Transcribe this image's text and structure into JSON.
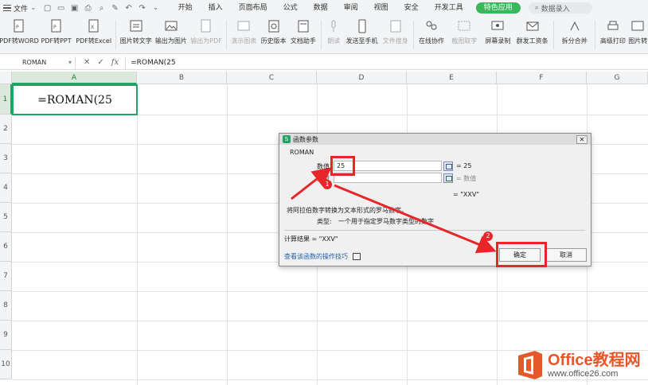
{
  "menubar": {
    "file": "文件",
    "tabs": [
      "开始",
      "插入",
      "页面布局",
      "公式",
      "数据",
      "审阅",
      "视图",
      "安全",
      "开发工具"
    ],
    "special_tab": "特色应用",
    "search": "数据录入"
  },
  "toolbar": {
    "items": [
      {
        "label": "PDF转WORD",
        "icon": "pdf-to-word-icon",
        "enabled": true
      },
      {
        "label": "PDF转PPT",
        "icon": "pdf-to-ppt-icon",
        "enabled": true
      },
      {
        "label": "PDF转Excel",
        "icon": "pdf-to-excel-icon",
        "enabled": true
      },
      {
        "label": "图片转文字",
        "icon": "image-to-text-icon",
        "enabled": true
      },
      {
        "label": "输出为图片",
        "icon": "export-image-icon",
        "enabled": true
      },
      {
        "label": "输出为PDF",
        "icon": "export-pdf-icon",
        "enabled": false
      },
      {
        "label": "演示图表",
        "icon": "demo-chart-icon",
        "enabled": false
      },
      {
        "label": "历史版本",
        "icon": "history-icon",
        "enabled": true
      },
      {
        "label": "文档助手",
        "icon": "doc-assistant-icon",
        "enabled": true
      },
      {
        "label": "朗读",
        "icon": "read-aloud-icon",
        "enabled": false
      },
      {
        "label": "发送至手机",
        "icon": "send-phone-icon",
        "enabled": true
      },
      {
        "label": "文件搜身",
        "icon": "file-search-icon",
        "enabled": false
      },
      {
        "label": "在线协作",
        "icon": "online-collab-icon",
        "enabled": true
      },
      {
        "label": "截图取字",
        "icon": "screenshot-text-icon",
        "enabled": false
      },
      {
        "label": "屏幕录制",
        "icon": "screen-record-icon",
        "enabled": true
      },
      {
        "label": "群发工资条",
        "icon": "payroll-icon",
        "enabled": true
      },
      {
        "label": "拆分合并",
        "icon": "split-merge-icon",
        "enabled": true
      },
      {
        "label": "高级打印",
        "icon": "advanced-print-icon",
        "enabled": true
      },
      {
        "label": "图片转",
        "icon": "image-convert-icon",
        "enabled": true
      }
    ]
  },
  "formula_bar": {
    "name_box": "ROMAN",
    "formula": "=ROMAN(25"
  },
  "sheet": {
    "columns": [
      "A",
      "B",
      "C",
      "D",
      "E",
      "F",
      "G"
    ],
    "rows": [
      "1",
      "2",
      "3",
      "4",
      "5",
      "6",
      "7",
      "8",
      "9",
      "10"
    ],
    "active_cell_text": "=ROMAN(25"
  },
  "dialog": {
    "title": "函数参数",
    "function_name": "ROMAN",
    "arg1_label": "数值",
    "arg1_value": "25",
    "arg1_result": "= 25",
    "arg2_label": "类型",
    "arg2_result": "= 数值",
    "formula_result": "= \"XXV\"",
    "description": "将阿拉伯数字转换为文本形式的罗马数字。",
    "type_desc_label": "类型:",
    "type_desc": "一个用于指定罗马数字类型的数字",
    "calc_result": "计算结果 = \"XXV\"",
    "help_link": "查看该函数的操作技巧",
    "ok": "确定",
    "cancel": "取消"
  },
  "annotations": {
    "badge1": "1",
    "badge2": "2",
    "color": "#e8262a"
  },
  "watermark": {
    "title": "Office教程网",
    "url": "www.office26.com"
  },
  "colors": {
    "accent": "#21a366",
    "special_tab": "#3ab75a",
    "annotation": "#e8262a"
  }
}
